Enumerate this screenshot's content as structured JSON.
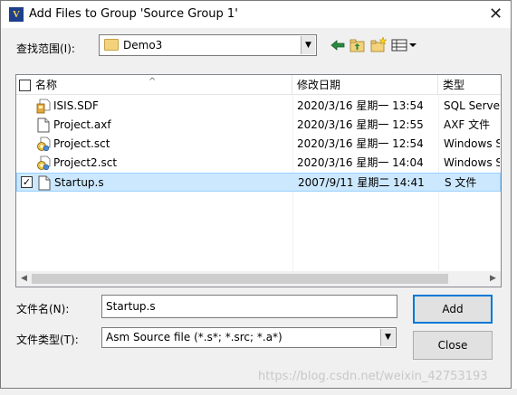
{
  "window": {
    "title": "Add Files to Group 'Source Group 1'",
    "close_glyph": "✕",
    "app_icon_letter": "V"
  },
  "look_in": {
    "label": "查找范围(I):",
    "value": "Demo3"
  },
  "toolbar": [
    "back-arrow-icon",
    "up-folder-icon",
    "new-folder-icon",
    "view-menu-icon"
  ],
  "columns": {
    "name": "名称",
    "date": "修改日期",
    "type": "类型"
  },
  "files": [
    {
      "name": "ISIS.SDF",
      "date": "2020/3/16 星期一 13:54",
      "type": "SQL Server",
      "icon": "sdf-file-icon",
      "checked": false,
      "selected": false
    },
    {
      "name": "Project.axf",
      "date": "2020/3/16 星期一 12:55",
      "type": "AXF 文件",
      "icon": "generic-file-icon",
      "checked": false,
      "selected": false
    },
    {
      "name": "Project.sct",
      "date": "2020/3/16 星期一 12:54",
      "type": "Windows S",
      "icon": "script-gear-icon",
      "checked": false,
      "selected": false
    },
    {
      "name": "Project2.sct",
      "date": "2020/3/16 星期一 14:04",
      "type": "Windows S",
      "icon": "script-gear-icon",
      "checked": false,
      "selected": false
    },
    {
      "name": "Startup.s",
      "date": "2007/9/11 星期二 14:41",
      "type": "S 文件",
      "icon": "generic-file-icon",
      "checked": true,
      "selected": true
    }
  ],
  "file_name": {
    "label": "文件名(N):",
    "value": "Startup.s"
  },
  "file_type": {
    "label": "文件类型(T):",
    "value": "Asm Source file (*.s*; *.src; *.a*)"
  },
  "buttons": {
    "add": "Add",
    "close": "Close"
  },
  "watermark": "https://blog.csdn.net/weixin_42753193",
  "colors": {
    "selection": "#cce8ff",
    "selection_border": "#99d1ff",
    "default_button_border": "#0078d7",
    "folder": "#f4d27b"
  }
}
